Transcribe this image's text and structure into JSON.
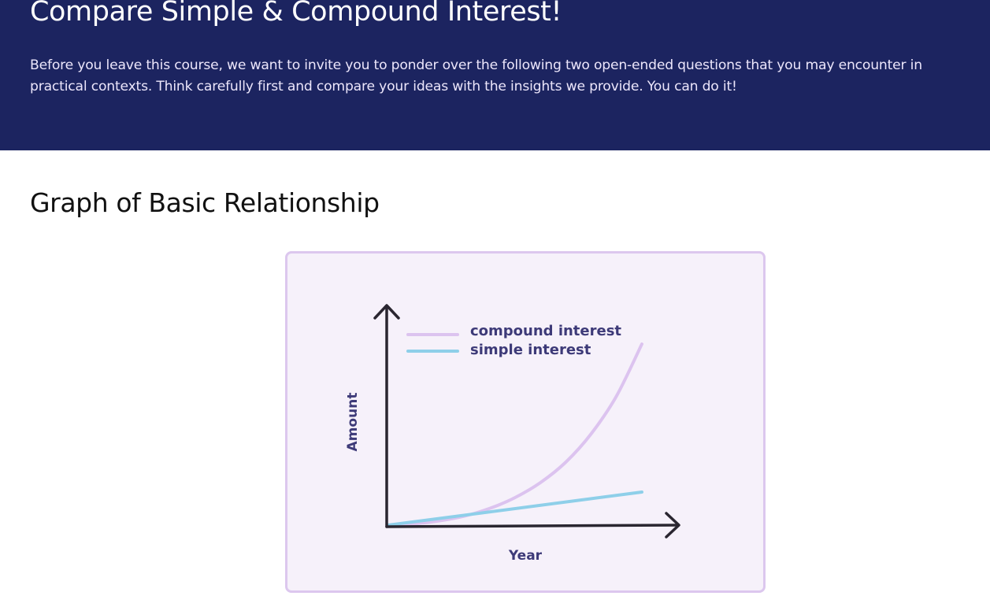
{
  "hero": {
    "title": "Compare Simple & Compound Interest!",
    "description": "Before you leave this course, we want to invite you to ponder over the following two open-ended questions that you may encounter in practical contexts. Think carefully first and compare your ideas with the insights we provide. You can do it!",
    "background_color": "#1c2460"
  },
  "section": {
    "title": "Graph of Basic Relationship"
  },
  "chart_data": {
    "type": "line",
    "title": "",
    "xlabel": "Year",
    "ylabel": "Amount",
    "legend_placement": "top-left",
    "grid": false,
    "series": [
      {
        "name": "compound interest",
        "color": "#dcc3ef",
        "x": [
          0,
          1,
          2,
          3,
          4,
          5,
          6,
          7,
          8,
          9,
          10
        ],
        "values": [
          1.0,
          1.08,
          1.27,
          1.57,
          2.06,
          2.75,
          3.7,
          5.0,
          6.8,
          9.2,
          12.5
        ]
      },
      {
        "name": "simple interest",
        "color": "#8ecfe9",
        "x": [
          0,
          10
        ],
        "values": [
          1.0,
          3.1
        ]
      }
    ]
  }
}
